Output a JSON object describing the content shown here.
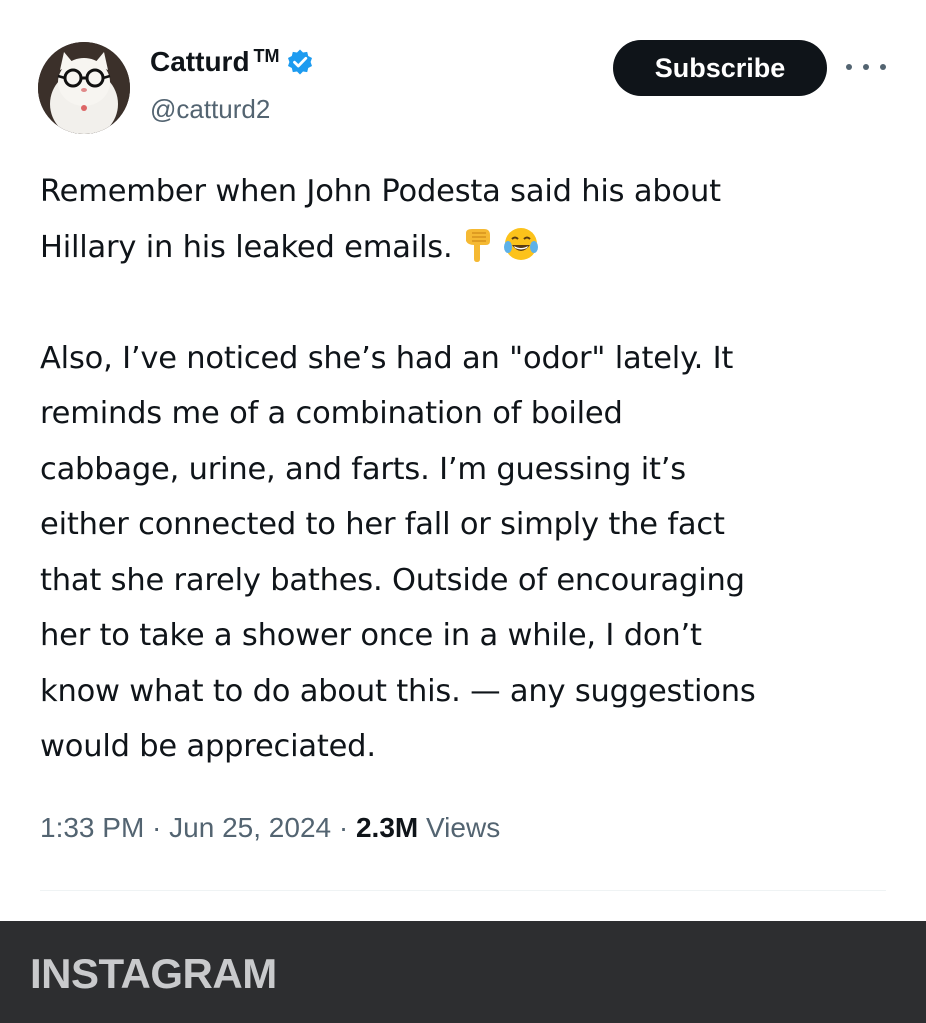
{
  "author": {
    "display_name": "Catturd",
    "trademark": "TM",
    "handle": "@catturd2",
    "verified_icon": "verified-badge-icon",
    "avatar_icon": "cat-with-glasses-avatar"
  },
  "actions": {
    "subscribe_label": "Subscribe",
    "more_icon": "more-options-icon"
  },
  "tweet": {
    "lines_paragraph_1": [
      "Remember when John Podesta said his about",
      "Hillary in his leaked emails."
    ],
    "emoji_1": "backhand-index-pointing-down-emoji",
    "emoji_2": "face-with-tears-of-joy-emoji",
    "lines_paragraph_2": [
      "Also, I’ve noticed she’s had an \"odor\" lately. It",
      "reminds me of a combination of boiled",
      "cabbage, urine, and farts. I’m guessing it’s",
      "either connected to her fall or simply the fact",
      "that she rarely bathes. Outside of encouraging",
      "her to take a shower once in a while, I don’t",
      "know what to do about this. — any suggestions",
      "would be appreciated."
    ]
  },
  "meta": {
    "time": "1:33 PM",
    "separator": " · ",
    "date": "Jun 25, 2024",
    "views_count": "2.3M",
    "views_label": " Views"
  },
  "footer": {
    "label": "INSTAGRAM"
  },
  "colors": {
    "text_primary": "#0f1419",
    "text_secondary": "#536471",
    "verified_blue": "#1d9bf0",
    "footer_bg": "#2d2e30"
  }
}
